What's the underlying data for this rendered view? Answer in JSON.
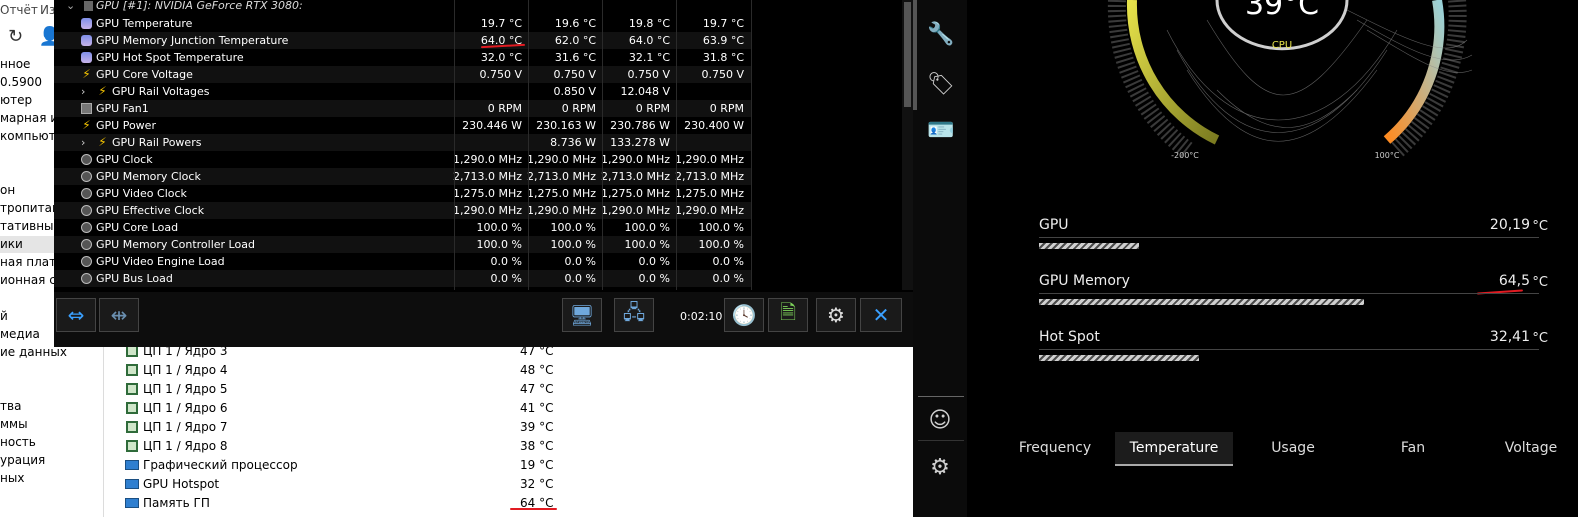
{
  "bg_app": {
    "menu": [
      "Отчёт",
      "Из"
    ],
    "left_tree": [
      "нное",
      "0.5900",
      "ютер",
      "марная ин",
      "компьюте",
      "",
      "",
      "он",
      "тропитани",
      "тативный",
      "ики",
      "ная плата",
      "ионная си",
      "",
      "й",
      "медиа",
      "ие данных",
      "",
      "",
      "тва",
      "ммы",
      "ность",
      "урация",
      "ныx"
    ],
    "sensors": [
      {
        "name": "ЦП 1 / Ядро 3",
        "value": "47 °C",
        "icon": "chip-icon"
      },
      {
        "name": "ЦП 1 / Ядро 4",
        "value": "48 °C",
        "icon": "chip-icon"
      },
      {
        "name": "ЦП 1 / Ядро 5",
        "value": "47 °C",
        "icon": "chip-icon"
      },
      {
        "name": "ЦП 1 / Ядро 6",
        "value": "41 °C",
        "icon": "chip-icon"
      },
      {
        "name": "ЦП 1 / Ядро 7",
        "value": "39 °C",
        "icon": "chip-icon"
      },
      {
        "name": "ЦП 1 / Ядро 8",
        "value": "38 °C",
        "icon": "chip-icon"
      },
      {
        "name": "Графический процессор",
        "value": "19 °C",
        "icon": "monitor-icon"
      },
      {
        "name": "GPU Hotspot",
        "value": "32 °C",
        "icon": "monitor-icon"
      },
      {
        "name": "Память ГП",
        "value": "64 °C",
        "icon": "monitor-icon"
      }
    ]
  },
  "hwinfo": {
    "header": "GPU [#1]: NVIDIA GeForce RTX 3080:",
    "rows": [
      {
        "name": "GPU Temperature",
        "icon": "thermometer-icon",
        "v": [
          "19.7 °C",
          "19.6 °C",
          "19.8 °C",
          "19.7 °C"
        ]
      },
      {
        "name": "GPU Memory Junction Temperature",
        "icon": "thermometer-icon",
        "v": [
          "64.0 °C",
          "62.0 °C",
          "64.0 °C",
          "63.9 °C"
        ]
      },
      {
        "name": "GPU Hot Spot Temperature",
        "icon": "thermometer-icon",
        "v": [
          "32.0 °C",
          "31.6 °C",
          "32.1 °C",
          "31.8 °C"
        ]
      },
      {
        "name": "GPU Core Voltage",
        "icon": "bolt-icon",
        "v": [
          "0.750 V",
          "0.750 V",
          "0.750 V",
          "0.750 V"
        ]
      },
      {
        "name": "GPU Rail Voltages",
        "icon": "bolt-icon",
        "sub": true,
        "v": [
          "",
          "0.850 V",
          "12.048 V",
          ""
        ]
      },
      {
        "name": "GPU Fan1",
        "icon": "fan-icon",
        "v": [
          "0 RPM",
          "0 RPM",
          "0 RPM",
          "0 RPM"
        ]
      },
      {
        "name": "GPU Power",
        "icon": "bolt-icon",
        "v": [
          "230.446 W",
          "230.163 W",
          "230.786 W",
          "230.400 W"
        ]
      },
      {
        "name": "GPU Rail Powers",
        "icon": "bolt-icon",
        "sub": true,
        "v": [
          "",
          "8.736 W",
          "133.278 W",
          ""
        ]
      },
      {
        "name": "GPU Clock",
        "icon": "clock-icon",
        "v": [
          "1,290.0 MHz",
          "1,290.0 MHz",
          "1,290.0 MHz",
          "1,290.0 MHz"
        ]
      },
      {
        "name": "GPU Memory Clock",
        "icon": "clock-icon",
        "v": [
          "2,713.0 MHz",
          "2,713.0 MHz",
          "2,713.0 MHz",
          "2,713.0 MHz"
        ]
      },
      {
        "name": "GPU Video Clock",
        "icon": "clock-icon",
        "v": [
          "1,275.0 MHz",
          "1,275.0 MHz",
          "1,275.0 MHz",
          "1,275.0 MHz"
        ]
      },
      {
        "name": "GPU Effective Clock",
        "icon": "clock-icon",
        "v": [
          "1,290.0 MHz",
          "1,290.0 MHz",
          "1,290.0 MHz",
          "1,290.0 MHz"
        ]
      },
      {
        "name": "GPU Core Load",
        "icon": "clock-icon",
        "v": [
          "100.0 %",
          "100.0 %",
          "100.0 %",
          "100.0 %"
        ]
      },
      {
        "name": "GPU Memory Controller Load",
        "icon": "clock-icon",
        "v": [
          "100.0 %",
          "100.0 %",
          "100.0 %",
          "100.0 %"
        ]
      },
      {
        "name": "GPU Video Engine Load",
        "icon": "clock-icon",
        "v": [
          "0.0 %",
          "0.0 %",
          "0.0 %",
          "0.0 %"
        ]
      },
      {
        "name": "GPU Bus Load",
        "icon": "clock-icon",
        "v": [
          "0.0 %",
          "0.0 %",
          "0.0 %",
          "0.0 %"
        ]
      }
    ],
    "timer": "0:02:10"
  },
  "msi": {
    "gauge": {
      "value": "39°C",
      "label": "CPU",
      "min_label": "-200°C",
      "max_label": "100°C"
    },
    "metrics": [
      {
        "label": "GPU",
        "value": "20,19",
        "unit": "°C",
        "level": 0.2
      },
      {
        "label": "GPU Memory",
        "value": "64,5",
        "unit": "°C",
        "level": 0.65
      },
      {
        "label": "Hot Spot",
        "value": "32,41",
        "unit": "°C",
        "level": 0.32
      }
    ],
    "tabs": [
      "Frequency",
      "Temperature",
      "Usage",
      "Fan",
      "Voltage"
    ],
    "active_tab": "Temperature"
  },
  "colors": {
    "accent_yellow": "#e6e24a",
    "accent_orange": "#ff8a1f",
    "annotation_red": "#e11b22"
  }
}
